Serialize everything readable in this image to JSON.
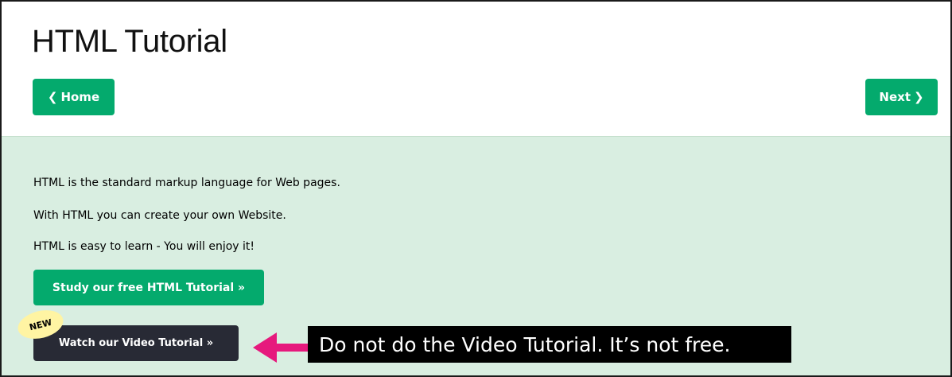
{
  "page": {
    "title": "HTML Tutorial"
  },
  "nav": {
    "home_label": "Home",
    "next_label": "Next",
    "home_icon": "chevron-left-icon",
    "next_icon": "chevron-right-icon",
    "button_color": "#04AA6D"
  },
  "intro": {
    "paragraphs": [
      "HTML is the standard markup language for Web pages.",
      "With HTML you can create your own Website.",
      "HTML is easy to learn - You will enjoy it!"
    ],
    "panel_color": "#D9EEE1"
  },
  "buttons": {
    "study_label": "Study our free HTML Tutorial »",
    "video_label": "Watch our Video Tutorial »",
    "video_color": "#282A35",
    "new_badge": "NEW",
    "new_badge_color": "#FFF4A3"
  },
  "annotation": {
    "text": "Do not do the Video Tutorial. It’s not free.",
    "arrow_color": "#E6197D",
    "arrow_icon": "arrow-left-icon"
  }
}
